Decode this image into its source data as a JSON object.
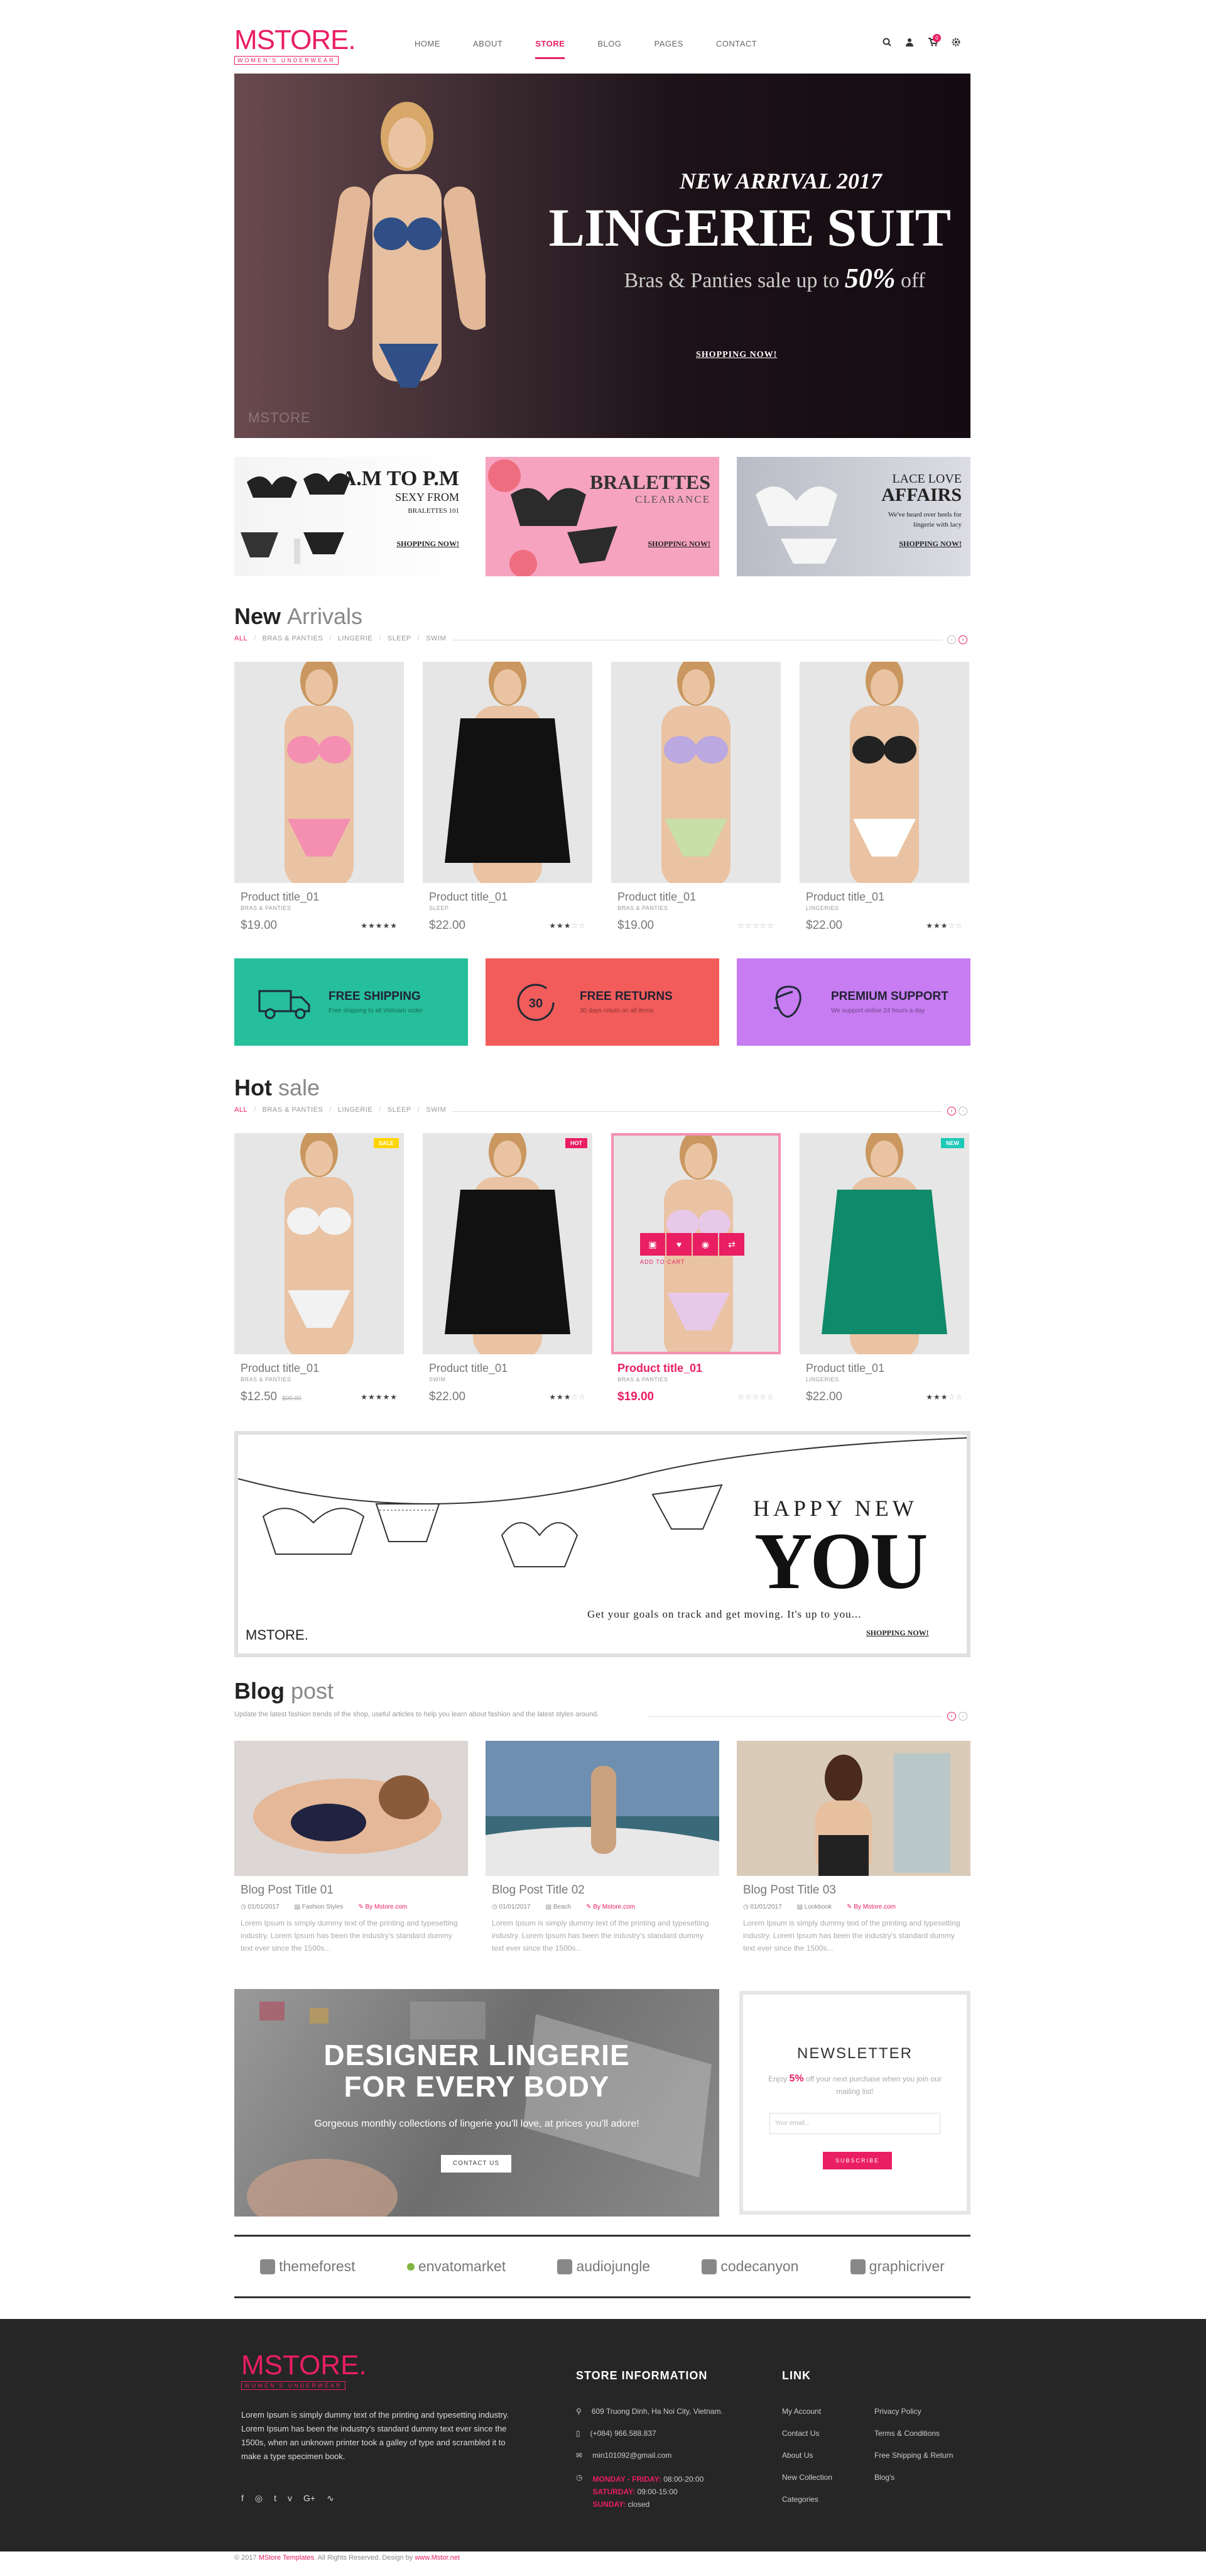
{
  "header": {
    "logo_text": "MSTORE.",
    "logo_sub": "WOMEN'S UNDERWEAR",
    "nav": [
      "HOME",
      "ABOUT",
      "STORE",
      "BLOG",
      "PAGES",
      "CONTACT"
    ],
    "active_nav": "STORE",
    "cart_count": "0"
  },
  "hero": {
    "line1": "NEW ARRIVAL 2017",
    "line2": "LINGERIE SUIT",
    "line3": "Bras & Panties sale up to",
    "line3_highlight": "50%",
    "line3_end": "off",
    "button": "SHOPPING NOW!",
    "watermark": "MSTORE"
  },
  "promos": [
    {
      "title": "A.M TO P.M",
      "sub": "SEXY FROM",
      "sub2": "BRALETTES 101",
      "button": "SHOPPING NOW!"
    },
    {
      "title": "BRALETTES",
      "sub": "CLEARANCE",
      "button": "SHOPPING NOW!"
    },
    {
      "title": "LACE LOVE",
      "sub": "AFFAIRS",
      "sub2": "We've heard over heels for lingerie with lacy",
      "button": "SHOPPING NOW!"
    }
  ],
  "new_arrivals": {
    "title_bold": "New",
    "title_light": "Arrivals",
    "tabs": [
      "ALL",
      "BRAS & PANTIES",
      "LINGERIE",
      "SLEEP",
      "SWIM"
    ],
    "products": [
      {
        "title": "Product title_01",
        "category": "BRAS & PANTIES",
        "price": "$19.00",
        "rating": 5
      },
      {
        "title": "Product title_01",
        "category": "SLEEP",
        "price": "$22.00",
        "rating": 3
      },
      {
        "title": "Product title_01",
        "category": "BRAS & PANTIES",
        "price": "$19.00",
        "rating": 0
      },
      {
        "title": "Product title_01",
        "category": "LINGERIES",
        "price": "$22.00",
        "rating": 3
      }
    ]
  },
  "features": [
    {
      "title": "FREE SHIPPING",
      "desc": "Free shipping to all Vietnam order",
      "color": "#26bf9b"
    },
    {
      "title": "FREE RETURNS",
      "desc": "30 days return on all items",
      "color": "#f25c5a"
    },
    {
      "title": "PREMIUM SUPPORT",
      "desc": "We support online 24 hours a day",
      "color": "#c77cf2"
    }
  ],
  "hot_sale": {
    "title_bold": "Hot",
    "title_light": "sale",
    "tabs": [
      "ALL",
      "BRAS & PANTIES",
      "LINGERIE",
      "SLEEP",
      "SWIM"
    ],
    "products": [
      {
        "title": "Product title_01",
        "category": "BRAS & PANTIES",
        "price": "$12.50",
        "old_price": "$00.00",
        "rating": 5,
        "badge": "SALE",
        "badge_color": "#ffd500"
      },
      {
        "title": "Product title_01",
        "category": "SWIM",
        "price": "$22.00",
        "rating": 3,
        "badge": "HOT",
        "badge_color": "#e91e63"
      },
      {
        "title": "Product title_01",
        "category": "BRAS & PANTIES",
        "price": "$19.00",
        "rating": 0,
        "add_to_cart": "ADD TO CART"
      },
      {
        "title": "Product title_01",
        "category": "LINGERIES",
        "price": "$22.00",
        "rating": 3,
        "badge": "NEW",
        "badge_color": "#1ec8b7"
      }
    ]
  },
  "happy": {
    "line1": "HAPPY NEW",
    "line2": "YOU",
    "desc": "Get your goals on track and get moving. It's up to you...",
    "button": "SHOPPING NOW!",
    "logo": "MSTORE."
  },
  "blog": {
    "title_bold": "Blog",
    "title_light": "post",
    "desc": "Update the latest fashion trends of the shop, useful articles to help you learn about fashion and the latest styles around.",
    "posts": [
      {
        "title": "Blog Post Title 01",
        "date": "01/01/2017",
        "category": "Fashion Styles",
        "author": "By Mstore.com",
        "excerpt": "Lorem Ipsum is simply dummy text of the printing and typesetting industry. Lorem Ipsum has been the industry's standard dummy text ever since the 1500s..."
      },
      {
        "title": "Blog Post Title 02",
        "date": "01/01/2017",
        "category": "Beach",
        "author": "By Mstore.com",
        "excerpt": "Lorem Ipsum is simply dummy text of the printing and typesetting industry. Lorem Ipsum has been the industry's standard dummy text ever since the 1500s..."
      },
      {
        "title": "Blog Post Title 03",
        "date": "01/01/2017",
        "category": "Lookbook",
        "author": "By Mstore.com",
        "excerpt": "Lorem Ipsum is simply dummy text of the printing and typesetting industry. Lorem Ipsum has been the industry's standard dummy text ever since the 1500s..."
      }
    ]
  },
  "designer": {
    "title": "DESIGNER LINGERIE FOR EVERY BODY",
    "desc": "Gorgeous monthly collections of lingerie you'll love, at prices you'll adore!",
    "button": "CONTACT US"
  },
  "newsletter": {
    "title": "NEWSLETTER",
    "desc_pre": "Enjoy",
    "desc_hl": "5%",
    "desc_post": "off your next purchase when you join our mailing list!",
    "placeholder": "Your email...",
    "button": "SUBSCRIBE"
  },
  "brands": [
    "themeforest",
    "envatomarket",
    "audiojungle",
    "codecanyon",
    "graphicriver"
  ],
  "footer": {
    "logo": "MSTORE.",
    "logo_sub": "WOMEN'S UNDERWEAR",
    "desc": "Lorem Ipsum is simply dummy text of the printing and typesetting industry. Lorem Ipsum has been the industry's standard dummy text ever since the 1500s, when an unknown printer took a galley of type and scrambled it to make a type specimen book.",
    "store_title": "STORE INFORMATION",
    "address": "609 Truong Dinh, Ha Noi City, Vietnam.",
    "phone": "(+084) 966.588.837",
    "email": "min101092@gmail.com",
    "hours": [
      {
        "day": "MONDAY - FRIDAY:",
        "time": "08:00-20:00"
      },
      {
        "day": "SATURDAY:",
        "time": "09:00-15:00"
      },
      {
        "day": "SUNDAY:",
        "time": "closed"
      }
    ],
    "link_title": "LINK",
    "links_col1": [
      "My Account",
      "Contact Us",
      "About Us",
      "New Collection",
      "Categories"
    ],
    "links_col2": [
      "Privacy Policy",
      "Terms & Conditions",
      "Free Shipping & Return",
      "Blog's"
    ],
    "copyright_pre": "© 2017",
    "copyright_brand": "MStore Templates",
    "copyright_mid": ". All Rights Reserved. Design by",
    "copyright_link": "www.Mstor.net"
  }
}
